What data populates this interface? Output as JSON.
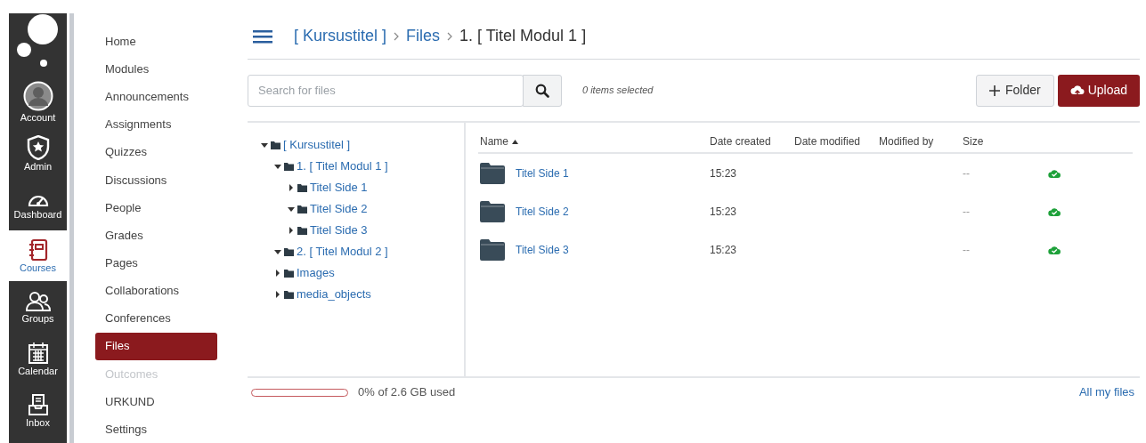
{
  "global_nav": [
    {
      "label": "Account",
      "kind": "avatar",
      "selected": false
    },
    {
      "label": "Admin",
      "kind": "shield",
      "selected": false
    },
    {
      "label": "Dashboard",
      "kind": "gauge",
      "selected": false
    },
    {
      "label": "Courses",
      "kind": "notebook",
      "selected": true
    },
    {
      "label": "Groups",
      "kind": "people",
      "selected": false
    },
    {
      "label": "Calendar",
      "kind": "calendar",
      "selected": false
    },
    {
      "label": "Inbox",
      "kind": "inbox",
      "selected": false
    }
  ],
  "course_nav": [
    {
      "label": "Home",
      "selected": false,
      "disabled": false
    },
    {
      "label": "Modules",
      "selected": false,
      "disabled": false
    },
    {
      "label": "Announcements",
      "selected": false,
      "disabled": false
    },
    {
      "label": "Assignments",
      "selected": false,
      "disabled": false
    },
    {
      "label": "Quizzes",
      "selected": false,
      "disabled": false
    },
    {
      "label": "Discussions",
      "selected": false,
      "disabled": false
    },
    {
      "label": "People",
      "selected": false,
      "disabled": false
    },
    {
      "label": "Grades",
      "selected": false,
      "disabled": false
    },
    {
      "label": "Pages",
      "selected": false,
      "disabled": false
    },
    {
      "label": "Collaborations",
      "selected": false,
      "disabled": false
    },
    {
      "label": "Conferences",
      "selected": false,
      "disabled": false
    },
    {
      "label": "Files",
      "selected": true,
      "disabled": false
    },
    {
      "label": "Outcomes",
      "selected": false,
      "disabled": true
    },
    {
      "label": "URKUND",
      "selected": false,
      "disabled": false
    },
    {
      "label": "Settings",
      "selected": false,
      "disabled": false
    }
  ],
  "breadcrumb": [
    "[ Kursustitel ]",
    "Files",
    "1. [ Titel Modul 1 ]"
  ],
  "search": {
    "placeholder": "Search for files"
  },
  "selection_count": "0 items selected",
  "buttons": {
    "folder": "Folder",
    "upload": "Upload"
  },
  "tree": [
    {
      "label": "[ Kursustitel ]",
      "expanded": true,
      "children": [
        {
          "label": "1. [ Titel Modul 1 ]",
          "expanded": true,
          "children": [
            {
              "label": "Titel Side 1",
              "expanded": false
            },
            {
              "label": "Titel Side 2",
              "expanded": true
            },
            {
              "label": "Titel Side 3",
              "expanded": false
            }
          ]
        },
        {
          "label": "2. [ Titel Modul 2 ]",
          "expanded": true
        },
        {
          "label": "Images",
          "expanded": false
        },
        {
          "label": "media_objects",
          "expanded": false
        }
      ]
    }
  ],
  "table": {
    "columns": [
      "Name",
      "Date created",
      "Date modified",
      "Modified by",
      "Size"
    ],
    "rows": [
      {
        "name": "Titel Side 1",
        "date_created": "15:23",
        "size": "--",
        "published": true
      },
      {
        "name": "Titel Side 2",
        "date_created": "15:23",
        "size": "--",
        "published": true
      },
      {
        "name": "Titel Side 3",
        "date_created": "15:23",
        "size": "--",
        "published": true
      }
    ]
  },
  "storage": {
    "level": 0,
    "label": "0% of 2.6 GB used"
  },
  "all_files_link": "All my files"
}
